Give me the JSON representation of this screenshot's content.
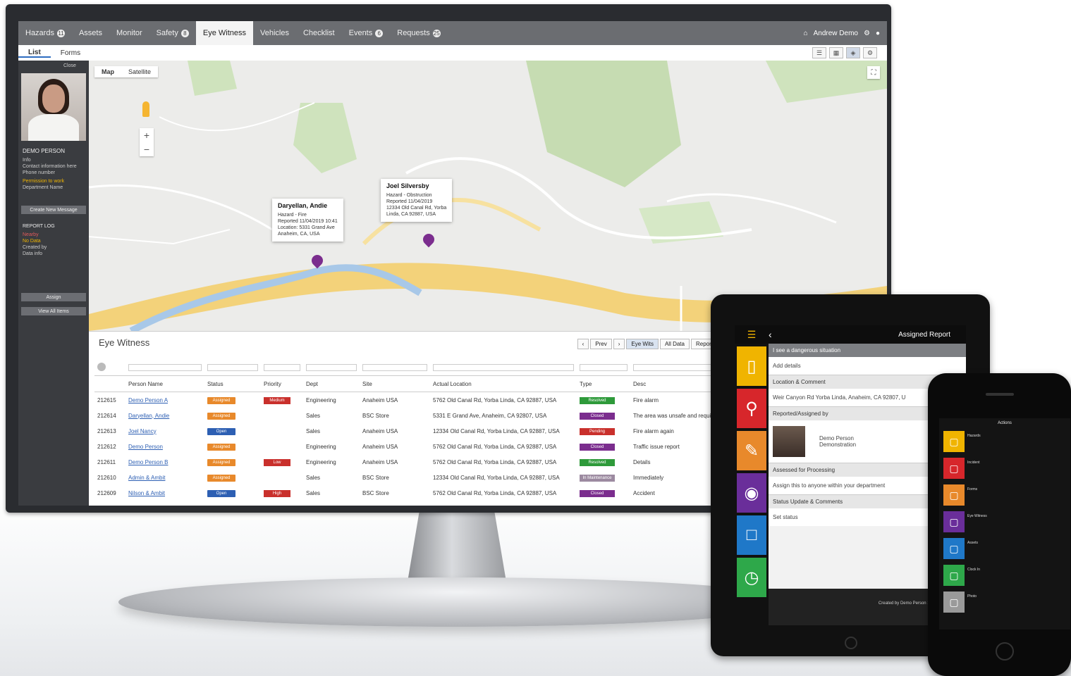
{
  "monitor": {
    "nav": {
      "tabs": [
        {
          "label": "Hazards",
          "badge": "11"
        },
        {
          "label": "Assets",
          "badge": ""
        },
        {
          "label": "Monitor",
          "badge": ""
        },
        {
          "label": "Safety",
          "badge": "8"
        },
        {
          "label": "Eye Witness",
          "badge": "",
          "active": true
        },
        {
          "label": "Vehicles",
          "badge": ""
        },
        {
          "label": "Checklist",
          "badge": ""
        },
        {
          "label": "Events",
          "badge": "6"
        },
        {
          "label": "Requests",
          "badge": "25"
        }
      ],
      "user": "Andrew Demo"
    },
    "subtabs": [
      "List",
      "Forms"
    ],
    "sidebar": {
      "close_label": "Close",
      "name": "DEMO PERSON",
      "lines": [
        "Info",
        "Contact information here",
        "Phone number",
        "Permission to work",
        "Department Name"
      ],
      "button1": "Create New Message",
      "report_title": "REPORT LOG",
      "report_lines": [
        "Nearby",
        "No Data",
        "Created by",
        "Data info"
      ],
      "btn2": "Assign",
      "btn3": "View All Items"
    },
    "map": {
      "tabs": [
        "Map",
        "Satellite"
      ],
      "popup1": {
        "title": "Daryellan, Andie",
        "lines": [
          "Hazard - Fire",
          "Reported 11/04/2019 10:41",
          "Location: 5331 Grand Ave",
          "Anaheim, CA, USA"
        ]
      },
      "popup2": {
        "title": "Joel Silversby",
        "lines": [
          "Hazard - Obstruction",
          "Reported 11/04/2019",
          "12334 Old Canal Rd, Yorba",
          "Linda, CA 92887, USA"
        ]
      }
    },
    "table": {
      "title": "Eye Witness",
      "pager": [
        "Prev",
        "Eye Wits",
        "All Data",
        "Reports"
      ],
      "columns": [
        "",
        "Person Name",
        "Status",
        "Priority",
        "Dept",
        "Site",
        "Actual Location",
        "Type",
        "Desc"
      ],
      "rows": [
        {
          "id": "212615",
          "name": "Demo Person A",
          "status": "Assigned",
          "status_color": "#e8892b",
          "priority": "Medium",
          "dept": "Engineering",
          "site": "Anaheim USA",
          "loc": "5762 Old Canal Rd, Yorba Linda, CA 92887, USA",
          "type": "Resolved",
          "type_color": "#2e9a3a",
          "desc": "Fire alarm"
        },
        {
          "id": "212614",
          "name": "Daryellan, Andie",
          "status": "Assigned",
          "status_color": "#e8892b",
          "priority": "",
          "dept": "Sales",
          "site": "BSC Store",
          "loc": "5331 E Grand Ave, Anaheim, CA 92807, USA",
          "type": "Closed",
          "type_color": "#7b2d8e",
          "desc": "The area was unsafe and required attention"
        },
        {
          "id": "212613",
          "name": "Joel Nancy",
          "status": "Open",
          "status_color": "#2d5fb3",
          "priority": "",
          "dept": "Sales",
          "site": "Anaheim USA",
          "loc": "12334 Old Canal Rd, Yorba Linda, CA 92887, USA",
          "type": "Pending",
          "type_color": "#c9302c",
          "desc": "Fire alarm again"
        },
        {
          "id": "212612",
          "name": "Demo Person",
          "status": "Assigned",
          "status_color": "#e8892b",
          "priority": "",
          "dept": "Engineering",
          "site": "Anaheim USA",
          "loc": "5762 Old Canal Rd, Yorba Linda, CA 92887, USA",
          "type": "Closed",
          "type_color": "#7b2d8e",
          "desc": "Traffic issue report"
        },
        {
          "id": "212611",
          "name": "Demo Person B",
          "status": "Assigned",
          "status_color": "#e8892b",
          "priority": "Low",
          "dept": "Engineering",
          "site": "Anaheim USA",
          "loc": "5762 Old Canal Rd, Yorba Linda, CA 92887, USA",
          "type": "Resolved",
          "type_color": "#2e9a3a",
          "desc": "Details"
        },
        {
          "id": "212610",
          "name": "Admin & Ambit",
          "status": "Assigned",
          "status_color": "#e8892b",
          "priority": "",
          "dept": "Sales",
          "site": "BSC Store",
          "loc": "12334 Old Canal Rd, Yorba Linda, CA 92887, USA",
          "type": "In Maintenance",
          "type_color": "#9c8aa0",
          "desc": "Immediately"
        },
        {
          "id": "212609",
          "name": "Nilson & Ambit",
          "status": "Open",
          "status_color": "#2d5fb3",
          "priority": "High",
          "dept": "Sales",
          "site": "BSC Store",
          "loc": "5762 Old Canal Rd, Yorba Linda, CA 92887, USA",
          "type": "Closed",
          "type_color": "#7b2d8e",
          "desc": "Accident"
        }
      ]
    }
  },
  "tablet": {
    "title": "Assigned Report",
    "header": "I see a dangerous situation",
    "rows": [
      {
        "kind": "row",
        "text": "Add details"
      },
      {
        "kind": "sec",
        "text": "Location & Comment"
      },
      {
        "kind": "row",
        "text": "Weir Canyon Rd Yorba Linda, Anaheim, CA 92807, U"
      },
      {
        "kind": "sec",
        "text": "Reported/Assigned by"
      },
      {
        "kind": "person",
        "text": "Demo Person",
        "sub": "Demonstration"
      },
      {
        "kind": "sec",
        "text": "Assessed for Processing"
      },
      {
        "kind": "row",
        "text": "Assign this to anyone within your department"
      },
      {
        "kind": "sec",
        "text": "Status Update & Comments"
      },
      {
        "kind": "row",
        "text": "Set status"
      }
    ],
    "footer": "Created by Demo Person 10/28/2019 12:34"
  },
  "phone": {
    "title": "Actions",
    "items": [
      {
        "label": "Hazards",
        "color": "#f0b400"
      },
      {
        "label": "Incident",
        "color": "#d7262b"
      },
      {
        "label": "Forms",
        "color": "#e8892b"
      },
      {
        "label": "Eye Witness",
        "color": "#6a2e9a"
      },
      {
        "label": "Assets",
        "color": "#1f78c8"
      },
      {
        "label": "Clock In",
        "color": "#2ea84a"
      },
      {
        "label": "Photo",
        "color": "#9a9a9a"
      }
    ]
  },
  "colors": {
    "tile_yellow": "#f0b400",
    "tile_red": "#d7262b",
    "tile_orange": "#e8892b",
    "tile_purple": "#6a2e9a",
    "tile_blue": "#1f78c8",
    "tile_green": "#2ea84a"
  }
}
